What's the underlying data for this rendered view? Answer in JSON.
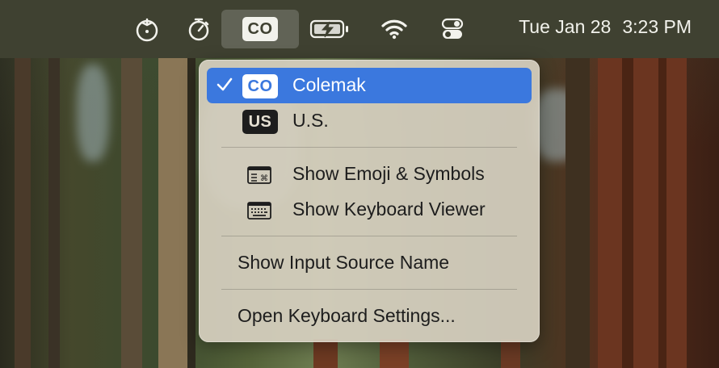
{
  "menubar": {
    "items": [
      {
        "name": "tomato-timer",
        "icon": "tomato-icon"
      },
      {
        "name": "stopwatch",
        "icon": "stopwatch-icon"
      },
      {
        "name": "input-source",
        "badge": "CO"
      },
      {
        "name": "battery",
        "icon": "battery-charging-icon"
      },
      {
        "name": "wifi",
        "icon": "wifi-icon"
      },
      {
        "name": "control-center",
        "icon": "control-center-icon"
      }
    ],
    "date": "Tue Jan 28",
    "time": "3:23 PM"
  },
  "input_menu": {
    "sources": [
      {
        "badge": "CO",
        "label": "Colemak",
        "checked": true
      },
      {
        "badge": "US",
        "label": "U.S.",
        "checked": false
      }
    ],
    "actions": [
      {
        "icon": "emoji-symbols-icon",
        "label": "Show Emoji & Symbols"
      },
      {
        "icon": "keyboard-viewer-icon",
        "label": "Show Keyboard Viewer"
      }
    ],
    "show_name_label": "Show Input Source Name",
    "settings_label": "Open Keyboard Settings..."
  },
  "colors": {
    "menubar": "#3f4131",
    "highlight": "#3b78de",
    "menu_bg": "#d6d0c0"
  }
}
